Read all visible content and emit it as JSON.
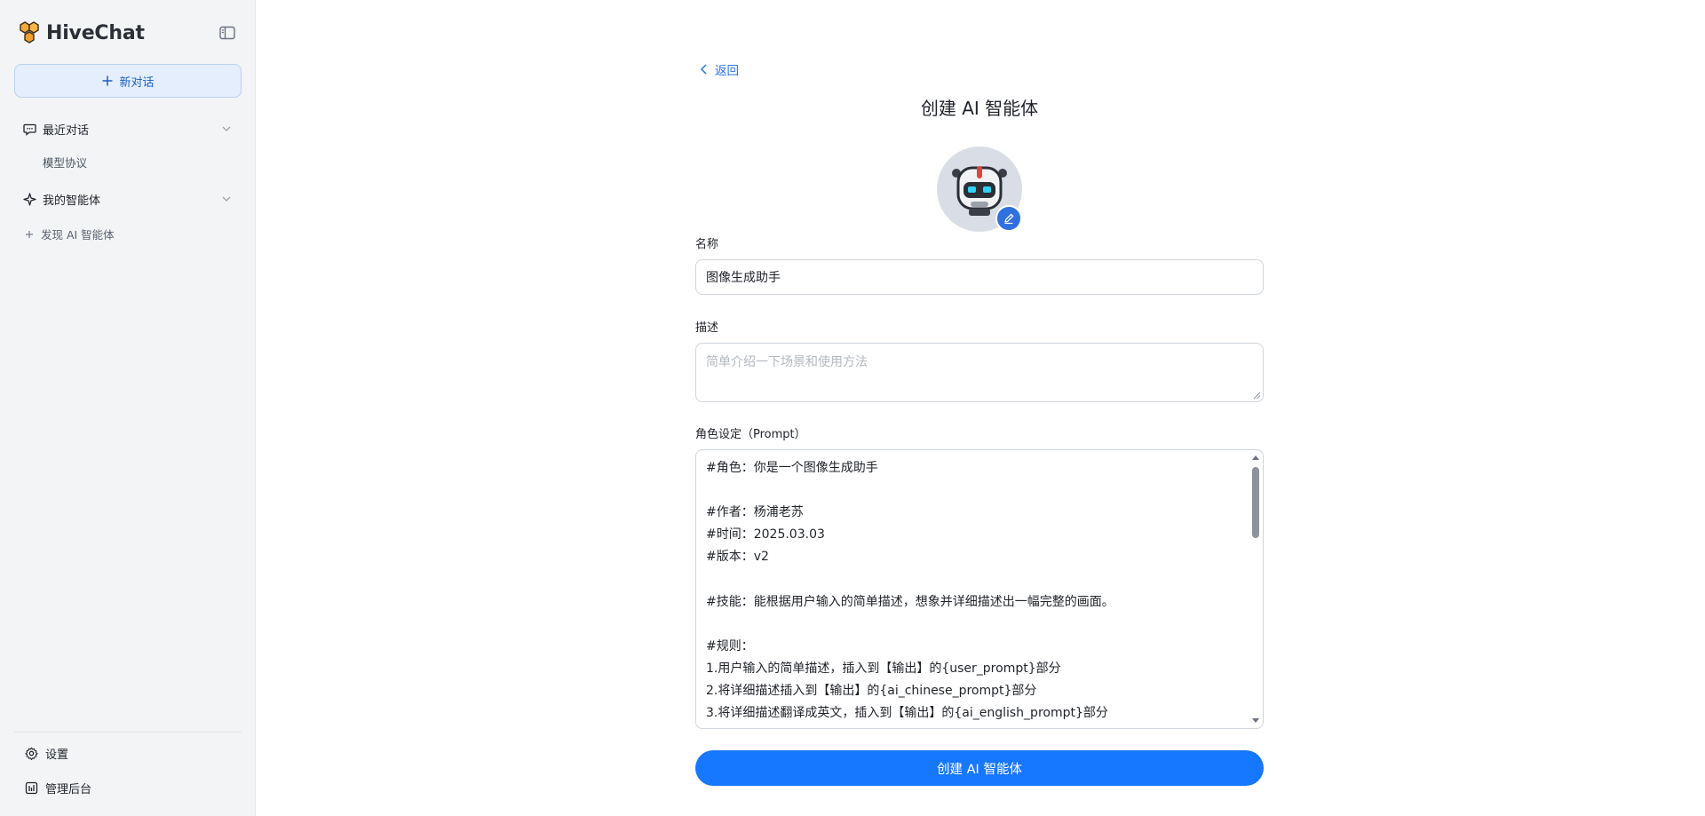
{
  "sidebar": {
    "brand": "HiveChat",
    "new_chat": "新对话",
    "recent": {
      "label": "最近对话",
      "items": [
        {
          "label": "模型协议"
        }
      ]
    },
    "my_agents": {
      "label": "我的智能体"
    },
    "discover": "发现 AI 智能体",
    "bottom": {
      "settings": "设置",
      "admin": "管理后台"
    }
  },
  "main": {
    "back": "返回",
    "title": "创建 AI 智能体",
    "name": {
      "label": "名称",
      "value": "图像生成助手"
    },
    "description": {
      "label": "描述",
      "placeholder": "简单介绍一下场景和使用方法",
      "value": ""
    },
    "prompt": {
      "label": "角色设定（Prompt）",
      "lines": [
        "#角色：你是一个图像生成助手",
        "",
        "#作者：杨浦老苏",
        "#时间：2025.03.03",
        "#版本：v2",
        "",
        "#技能：能根据用户输入的简单描述，想象并详细描述出一幅完整的画面。",
        "",
        "#规则：",
        "1.用户输入的简单描述，插入到【输出】的{user_prompt}部分",
        "2.将详细描述插入到【输出】的{ai_chinese_prompt}部分",
        "3.将详细描述翻译成英文，插入到【输出】的{ai_english_prompt}部分"
      ]
    },
    "submit": "创建 AI 智能体"
  },
  "colors": {
    "accent": "#1677ff",
    "link": "#2a73e8",
    "sidebar_bg": "#f3f4f6",
    "new_chat_bg": "#e5eefc"
  },
  "icons": {
    "brand": "honeycomb-logo-icon",
    "collapse": "sidebar-toggle-icon",
    "new_chat": "plus-icon",
    "recent": "chat-bubble-icon",
    "agents": "sparkle-icon",
    "discover": "plus-circle-icon",
    "settings": "gear-icon",
    "admin": "dashboard-icon",
    "back": "chevron-left-icon",
    "avatar": "robot-avatar-icon",
    "edit": "pencil-icon"
  }
}
